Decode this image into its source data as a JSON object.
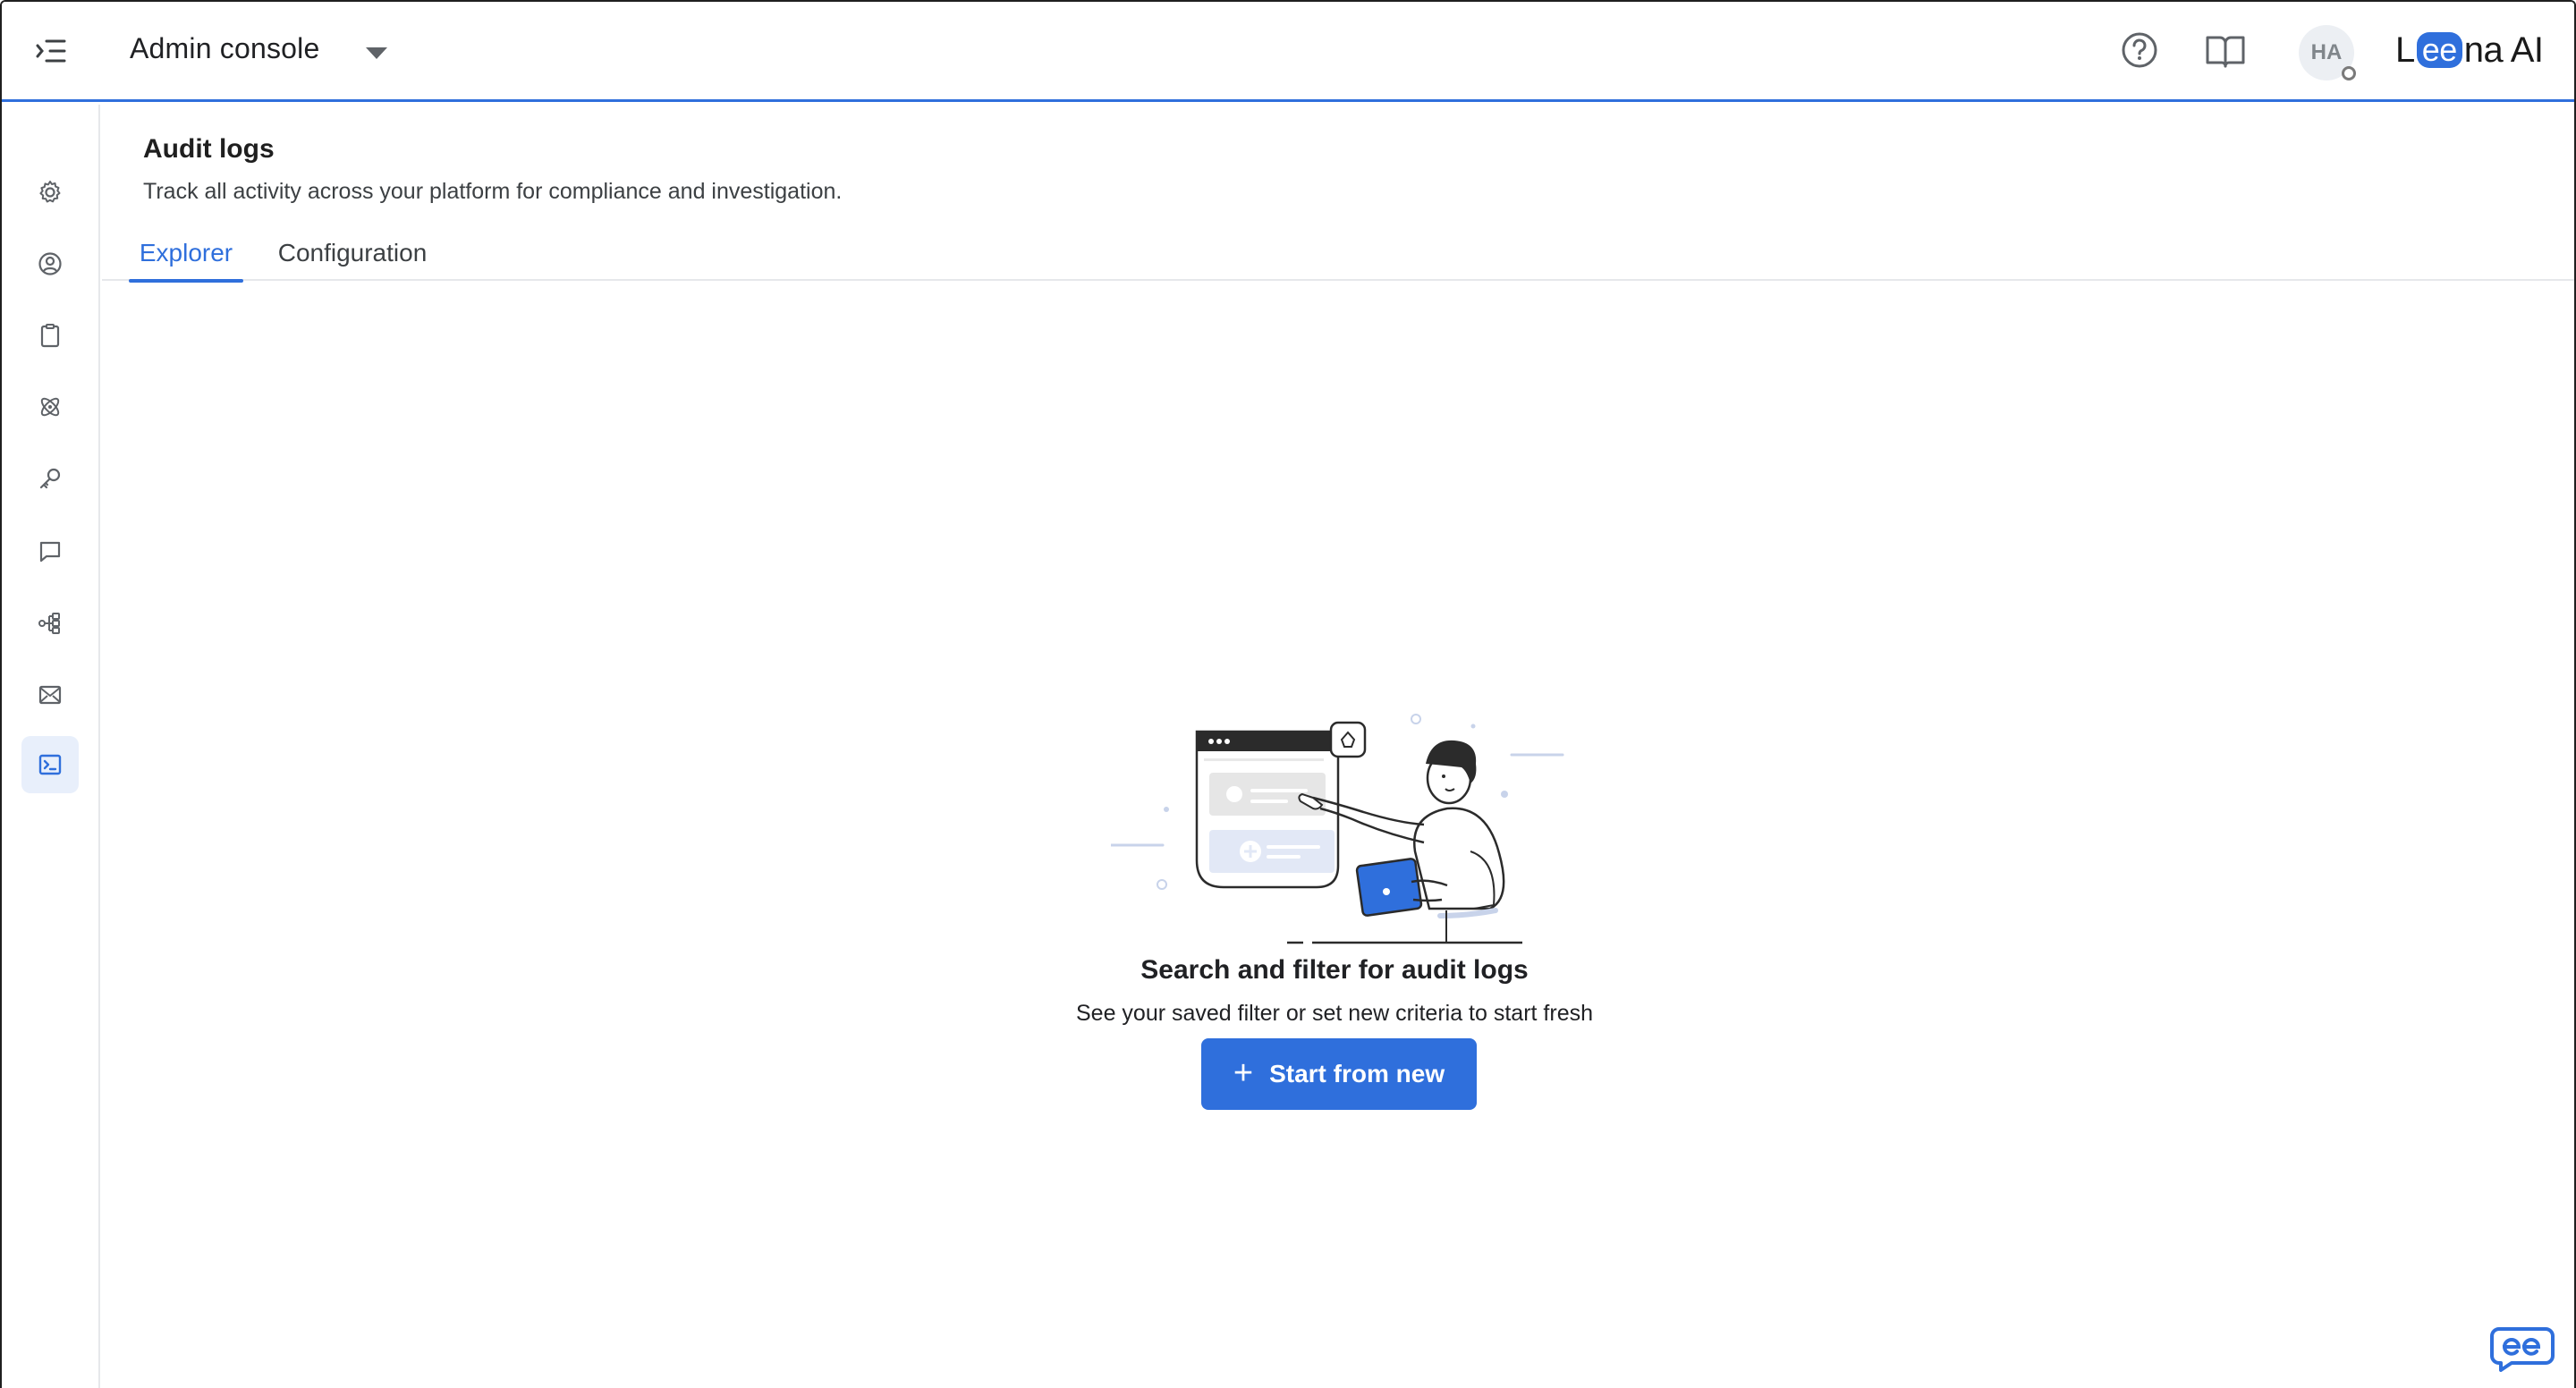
{
  "header": {
    "app_title": "Admin console",
    "avatar_initials": "HA",
    "brand_prefix": "L",
    "brand_ee": "ee",
    "brand_suffix": "na AI"
  },
  "sidebar": {
    "items": [
      {
        "icon": "gear-icon",
        "active": false
      },
      {
        "icon": "user-circle-icon",
        "active": false
      },
      {
        "icon": "clipboard-icon",
        "active": false
      },
      {
        "icon": "atom-icon",
        "active": false
      },
      {
        "icon": "key-icon",
        "active": false
      },
      {
        "icon": "chat-bubble-icon",
        "active": false
      },
      {
        "icon": "workflow-icon",
        "active": false
      },
      {
        "icon": "mail-icon",
        "active": false
      },
      {
        "icon": "terminal-icon",
        "active": true
      }
    ]
  },
  "page": {
    "title": "Audit logs",
    "subtitle": "Track all activity across your platform for compliance and investigation.",
    "tabs": [
      {
        "label": "Explorer",
        "active": true
      },
      {
        "label": "Configuration",
        "active": false
      }
    ]
  },
  "empty_state": {
    "title": "Search and filter for audit logs",
    "subtitle": "See your saved filter or set new criteria to start fresh",
    "button_label": "Start from new"
  },
  "colors": {
    "accent": "#2f6fdc",
    "active_nav_bg": "#e8effb",
    "divider": "#e6e8eb"
  }
}
